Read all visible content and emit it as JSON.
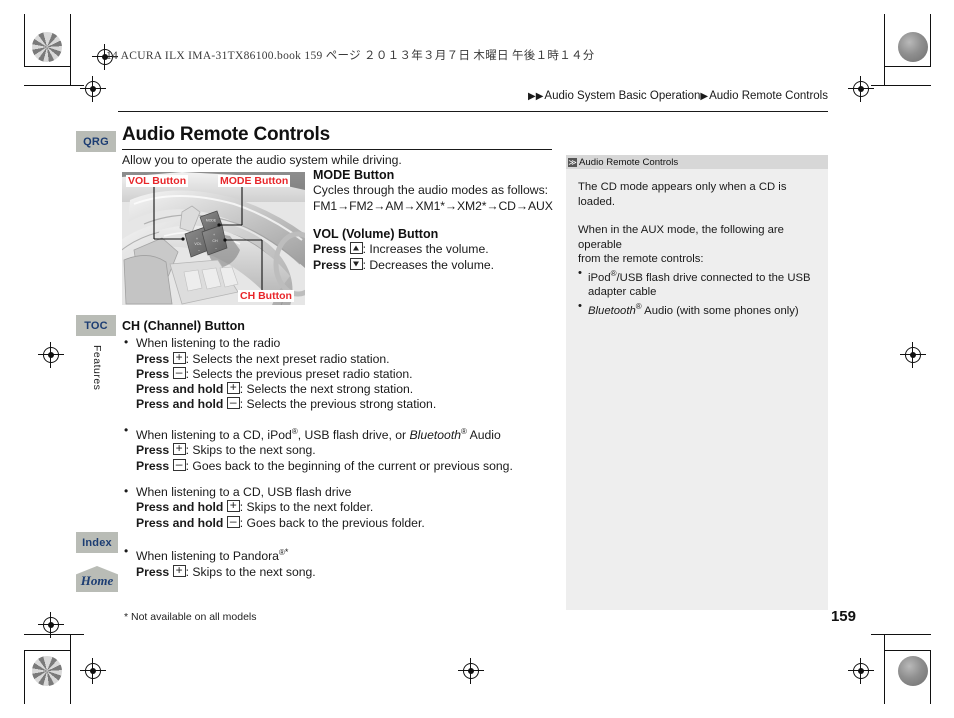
{
  "print_info": "14 ACURA ILX IMA-31TX86100.book   159 ページ   ２０１３年３月７日   木曜日   午後１時１４分",
  "breadcrumb": {
    "arrow1": "▶▶",
    "item1": "Audio System Basic Operation",
    "arrow2": "▶",
    "item2": "Audio Remote Controls"
  },
  "side_tabs": {
    "qrg": "QRG",
    "toc": "TOC",
    "index": "Index",
    "home": "Home",
    "vertical_label": "Features"
  },
  "main": {
    "title": "Audio Remote Controls",
    "intro": "Allow you to operate the audio system while driving.",
    "photo": {
      "alt": "steering-wheel-audio-remote-controls",
      "label_vol": "VOL Button",
      "label_mode": "MODE Button",
      "label_ch": "CH Button",
      "btn_mode_text": "MODE",
      "btn_vol_text": "VOL",
      "btn_ch_text": "CH"
    },
    "mode_button": {
      "heading": "MODE Button",
      "line1": "Cycles through the audio modes as follows:",
      "chain": "FM1→FM2→AM→XM1*→XM2*→CD→AUX"
    },
    "vol_button": {
      "heading": "VOL (Volume) Button",
      "press_label": "Press",
      "up_desc": ": Increases the volume.",
      "down_desc": ": Decreases the volume."
    },
    "ch_button": {
      "heading": "CH (Channel) Button",
      "groups": [
        {
          "bullet": "When listening to the radio",
          "lines": [
            {
              "action": "Press",
              "key": "plus",
              "desc": ": Selects the next preset radio station."
            },
            {
              "action": "Press",
              "key": "minus",
              "desc": ": Selects the previous preset radio station."
            },
            {
              "action": "Press and hold",
              "key": "plus",
              "desc": ": Selects the next strong station."
            },
            {
              "action": "Press and hold",
              "key": "minus",
              "desc": ": Selects the previous strong station."
            }
          ]
        },
        {
          "bullet_pre": "When listening to a CD, iPod",
          "bullet_sup": "®",
          "bullet_mid": ", USB flash drive, or ",
          "bullet_italic": "Bluetooth",
          "bullet_sup2": "®",
          "bullet_post": " Audio",
          "lines": [
            {
              "action": "Press",
              "key": "plus",
              "desc": ": Skips to the next song."
            },
            {
              "action": "Press",
              "key": "minus",
              "desc": ": Goes back to the beginning of the current or previous song."
            }
          ]
        },
        {
          "bullet": "When listening to a CD, USB flash drive",
          "lines": [
            {
              "action": "Press and hold",
              "key": "plus",
              "desc": ": Skips to the next folder."
            },
            {
              "action": "Press and hold",
              "key": "minus",
              "desc": ": Goes back to the previous folder."
            }
          ]
        },
        {
          "bullet_pre": "When listening to Pandora",
          "bullet_sup": "®",
          "bullet_star": "*",
          "lines": [
            {
              "action": "Press",
              "key": "plus",
              "desc": ": Skips to the next song."
            }
          ]
        }
      ]
    },
    "footnote": "* Not available on all models"
  },
  "info_panel": {
    "marker": "≫",
    "title": "Audio Remote Controls",
    "para1": "The CD mode appears only when a CD is loaded.",
    "para2_l1": "When in the AUX mode, the following are operable",
    "para2_l2": "from the remote controls:",
    "bullet1_pre": "iPod",
    "bullet1_sup": "®",
    "bullet1_post": "/USB flash drive connected to the USB",
    "bullet1_cont": "adapter cable",
    "bullet2_italic": "Bluetooth",
    "bullet2_sup": "®",
    "bullet2_post": " Audio (with some phones only)"
  },
  "page_number": "159",
  "colors": {
    "label_red": "#e8262a",
    "tab_gray": "#b9bcb6",
    "tab_text_blue": "#1c3d73",
    "panel_bg": "#eeeeee",
    "panel_head": "#d7d7d7"
  }
}
